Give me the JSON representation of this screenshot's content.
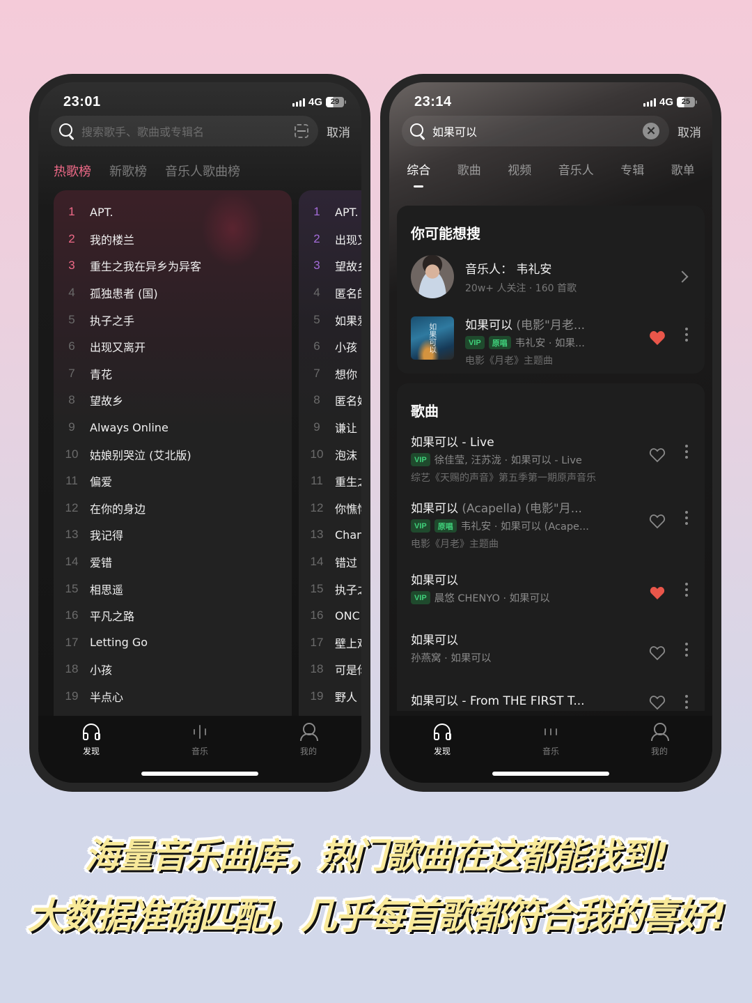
{
  "left_phone": {
    "status": {
      "time": "23:01",
      "network": "4G",
      "battery": "29"
    },
    "search": {
      "placeholder": "搜索歌手、歌曲或专辑名",
      "cancel_label": "取消"
    },
    "chart_tabs": [
      {
        "label": "热歌榜",
        "active": true
      },
      {
        "label": "新歌榜",
        "active": false
      },
      {
        "label": "音乐人歌曲榜",
        "active": false
      }
    ],
    "hot_chart": [
      {
        "rank": "1",
        "title": "APT."
      },
      {
        "rank": "2",
        "title": "我的楼兰"
      },
      {
        "rank": "3",
        "title": "重生之我在异乡为异客"
      },
      {
        "rank": "4",
        "title": "孤独患者 (国)"
      },
      {
        "rank": "5",
        "title": "执子之手"
      },
      {
        "rank": "6",
        "title": "出现又离开"
      },
      {
        "rank": "7",
        "title": "青花"
      },
      {
        "rank": "8",
        "title": "望故乡"
      },
      {
        "rank": "9",
        "title": "Always Online"
      },
      {
        "rank": "10",
        "title": "姑娘别哭泣 (艾北版)"
      },
      {
        "rank": "11",
        "title": "偏爱"
      },
      {
        "rank": "12",
        "title": "在你的身边"
      },
      {
        "rank": "13",
        "title": "我记得"
      },
      {
        "rank": "14",
        "title": "爱错"
      },
      {
        "rank": "15",
        "title": "相思遥"
      },
      {
        "rank": "16",
        "title": "平凡之路"
      },
      {
        "rank": "17",
        "title": "Letting Go"
      },
      {
        "rank": "18",
        "title": "小孩"
      },
      {
        "rank": "19",
        "title": "半点心"
      }
    ],
    "new_chart": [
      {
        "rank": "1",
        "title": "APT."
      },
      {
        "rank": "2",
        "title": "出现又"
      },
      {
        "rank": "3",
        "title": "望故乡"
      },
      {
        "rank": "4",
        "title": "匿名的"
      },
      {
        "rank": "5",
        "title": "如果爱"
      },
      {
        "rank": "6",
        "title": "小孩"
      },
      {
        "rank": "7",
        "title": "想你"
      },
      {
        "rank": "8",
        "title": "匿名好"
      },
      {
        "rank": "9",
        "title": "谦让"
      },
      {
        "rank": "10",
        "title": "泡沫"
      },
      {
        "rank": "11",
        "title": "重生之"
      },
      {
        "rank": "12",
        "title": "你憔悴"
      },
      {
        "rank": "13",
        "title": "Chan"
      },
      {
        "rank": "14",
        "title": "错过"
      },
      {
        "rank": "15",
        "title": "执子之"
      },
      {
        "rank": "16",
        "title": "ONC"
      },
      {
        "rank": "17",
        "title": "壁上观"
      },
      {
        "rank": "18",
        "title": "可是你"
      },
      {
        "rank": "19",
        "title": "野人"
      }
    ],
    "tabbar": [
      {
        "label": "发现",
        "icon": "headphones-icon",
        "active": true
      },
      {
        "label": "音乐",
        "icon": "audio-bars-icon",
        "active": false
      },
      {
        "label": "我的",
        "icon": "person-icon",
        "active": false
      }
    ]
  },
  "right_phone": {
    "status": {
      "time": "23:14",
      "network": "4G",
      "battery": "25"
    },
    "search": {
      "value": "如果可以",
      "cancel_label": "取消"
    },
    "result_tabs": [
      {
        "label": "综合",
        "active": true
      },
      {
        "label": "歌曲",
        "active": false
      },
      {
        "label": "视频",
        "active": false
      },
      {
        "label": "音乐人",
        "active": false
      },
      {
        "label": "专辑",
        "active": false
      },
      {
        "label": "歌单",
        "active": false
      }
    ],
    "suggest": {
      "title": "你可能想搜",
      "artist": {
        "name": "音乐人： 韦礼安",
        "meta": "20w+ 人关注 · 160 首歌"
      },
      "song": {
        "title": "如果可以",
        "subtitle": " (电影\"月老...",
        "badges": [
          "VIP",
          "原唱"
        ],
        "meta": "韦礼安 · 如果...",
        "desc": "电影《月老》主题曲",
        "album_text": "如果可以",
        "liked": true
      }
    },
    "songs": {
      "title": "歌曲",
      "items": [
        {
          "title": "如果可以 - Live",
          "subtitle": "",
          "badges": [
            "VIP"
          ],
          "meta": "徐佳莹, 汪苏泷 · 如果可以 - Live",
          "desc": "综艺《天赐的声音》第五季第一期原声音乐",
          "liked": false
        },
        {
          "title": "如果可以",
          "subtitle": " (Acapella) (电影\"月...",
          "badges": [
            "VIP",
            "原唱"
          ],
          "meta": "韦礼安 · 如果可以 (Acape...",
          "desc": "电影《月老》主题曲",
          "liked": false
        },
        {
          "title": "如果可以",
          "subtitle": "",
          "badges": [
            "VIP"
          ],
          "meta": "晨悠 CHENYO · 如果可以",
          "desc": "",
          "liked": true
        },
        {
          "title": "如果可以",
          "subtitle": "",
          "badges": [],
          "meta": "孙燕窝 · 如果可以",
          "desc": "",
          "liked": false
        },
        {
          "title": "如果可以 - From THE FIRST T...",
          "subtitle": "",
          "badges": [],
          "meta": "",
          "desc": "",
          "liked": false
        }
      ]
    },
    "tabbar": [
      {
        "label": "发现",
        "icon": "headphones-icon",
        "active": true
      },
      {
        "label": "音乐",
        "icon": "audio-bars-icon",
        "active": false
      },
      {
        "label": "我的",
        "icon": "person-icon",
        "active": false
      }
    ]
  },
  "captions": {
    "line1": "海量音乐曲库，热门歌曲在这都能找到!",
    "line2": "大数据准确匹配，几乎每首歌都符合我的喜好!"
  },
  "colors": {
    "hot_rank_accent": "#ef6a88",
    "new_rank_accent": "#a46cd8",
    "liked_heart": "#e9564a",
    "vip_badge": "#3fd07a",
    "caption_fill": "#f8e99a"
  }
}
